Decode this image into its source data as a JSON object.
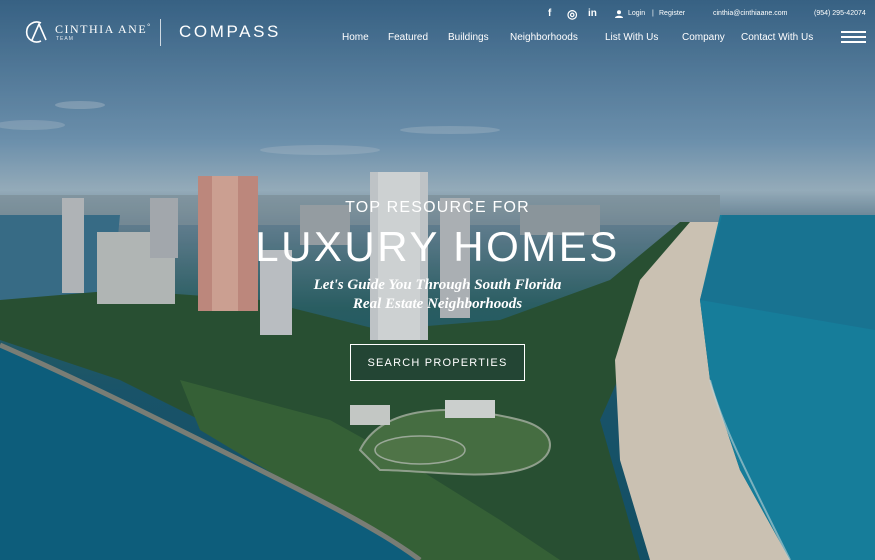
{
  "brand": {
    "agent_name": "CINTHIA ANE",
    "agent_mark": "°",
    "agent_team": "TEAM",
    "brokerage": "COMPASS"
  },
  "social": {
    "facebook": "f",
    "instagram": "◎",
    "linkedin": "in"
  },
  "utility": {
    "login": "Login",
    "separator": "|",
    "register": "Register",
    "email": "cinthia@cinthiaane.com",
    "phone": "(954) 295-42074"
  },
  "nav": {
    "items": [
      {
        "label": "Home"
      },
      {
        "label": "Featured"
      },
      {
        "label": "Buildings"
      },
      {
        "label": "Neighborhoods"
      },
      {
        "label": "List With Us"
      },
      {
        "label": "Company"
      },
      {
        "label": "Contact With Us"
      }
    ]
  },
  "hero": {
    "kicker": "TOP RESOURCE FOR",
    "headline": "LUXURY HOMES",
    "tagline_line1": "Let's Guide You Through South Florida",
    "tagline_line2": "Real Estate Neighborhoods",
    "cta_label": "SEARCH PROPERTIES"
  },
  "icons": {
    "logo": "ca-monogram-icon",
    "user": "user-icon",
    "menu": "hamburger-menu-icon"
  }
}
